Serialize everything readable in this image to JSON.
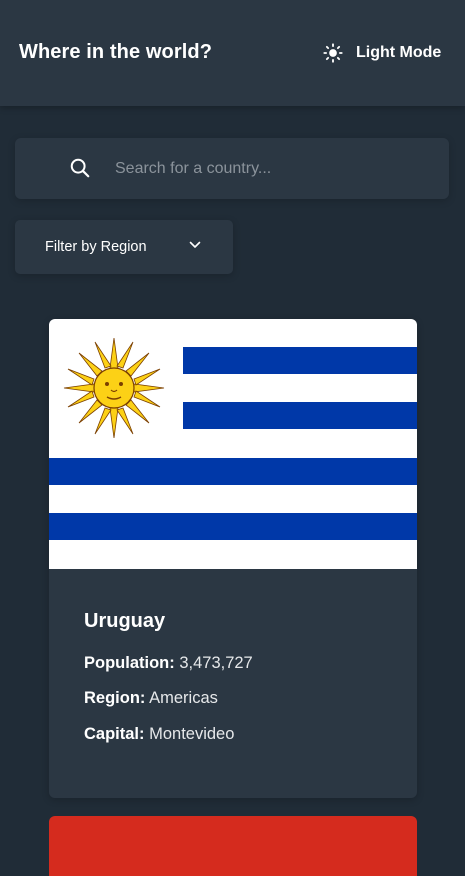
{
  "header": {
    "title": "Where in the world?",
    "mode_label": "Light Mode",
    "mode_icon": "sun-icon"
  },
  "search": {
    "placeholder": "Search for a country...",
    "value": "",
    "icon": "search-icon"
  },
  "filter": {
    "label": "Filter by Region",
    "icon": "chevron-down-icon"
  },
  "countries": [
    {
      "name": "Uruguay",
      "population_label": "Population:",
      "population": "3,473,727",
      "region_label": "Region:",
      "region": "Americas",
      "capital_label": "Capital:",
      "capital": "Montevideo",
      "flag": "uruguay-flag"
    }
  ],
  "colors": {
    "background": "#202c37",
    "element": "#2b3743",
    "text": "#ffffff",
    "placeholder": "#8b939b",
    "next_flag_red": "#d52b1e"
  }
}
